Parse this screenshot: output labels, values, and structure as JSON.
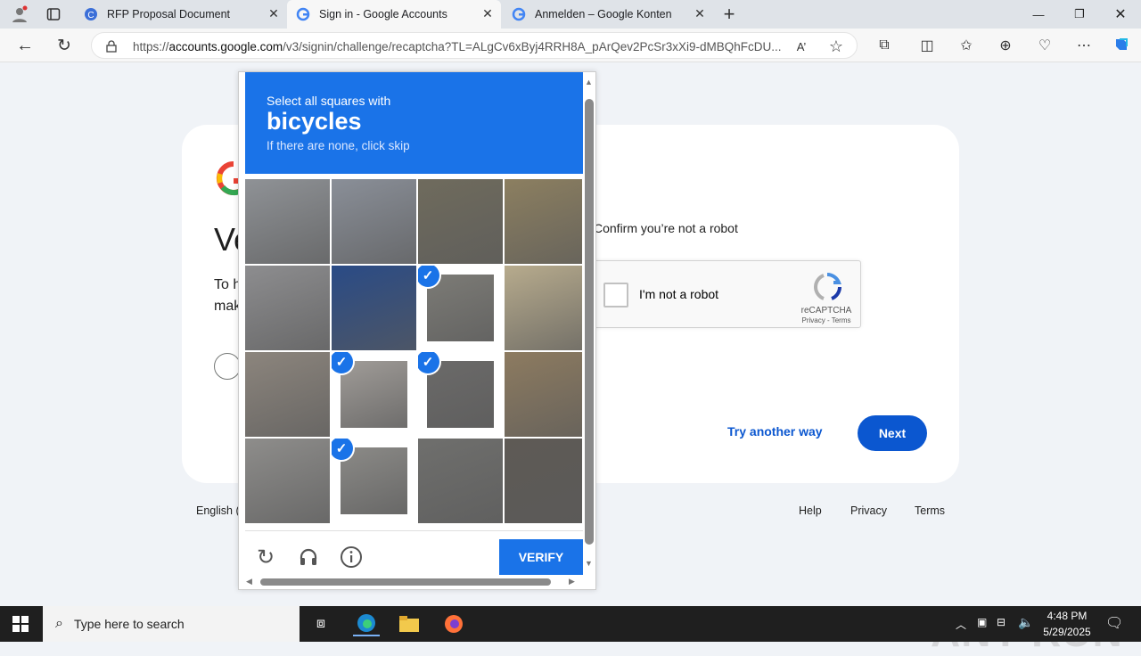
{
  "tabs": [
    {
      "title": "RFP Proposal Document",
      "icon": "edge-document-icon"
    },
    {
      "title": "Sign in - Google Accounts",
      "icon": "google-g-icon"
    },
    {
      "title": "Anmelden – Google Konten",
      "icon": "google-g-icon"
    }
  ],
  "address": {
    "url_prefix": "https://",
    "url_domain": "accounts.google.com",
    "url_path": "/v3/signin/challenge/recaptcha?TL=ALgCv6xByj4RRH8A_pArQev2PcSr3xXi9-dMBQhFcDU..."
  },
  "page": {
    "title_partial": "Ve",
    "text_partial": "To h mak mo",
    "confirm_text": "Confirm you’re not a robot",
    "recaptcha": {
      "label": "I'm not a robot",
      "brand": "reCAPTCHA",
      "links": "Privacy - Terms"
    },
    "try_another": "Try another way",
    "next": "Next",
    "lang_partial": "English (",
    "footer": {
      "help": "Help",
      "privacy": "Privacy",
      "terms": "Terms"
    }
  },
  "captcha": {
    "instruction": "Select all squares with",
    "target": "bicycles",
    "hint": "If there are none, click skip",
    "verify": "VERIFY",
    "tiles": [
      {
        "selected": false,
        "tone": "#8f9296"
      },
      {
        "selected": false,
        "tone": "#8a8f98"
      },
      {
        "selected": false,
        "tone": "#6f6b5d"
      },
      {
        "selected": false,
        "tone": "#8c7f60"
      },
      {
        "selected": false,
        "tone": "#8d8d8f"
      },
      {
        "selected": false,
        "tone": "#2a4b86"
      },
      {
        "selected": true,
        "tone": "#7c7b76"
      },
      {
        "selected": false,
        "tone": "#b7ab8d"
      },
      {
        "selected": false,
        "tone": "#8c857d"
      },
      {
        "selected": true,
        "tone": "#a09c98"
      },
      {
        "selected": true,
        "tone": "#6b6a69"
      },
      {
        "selected": false,
        "tone": "#8d7b60"
      },
      {
        "selected": false,
        "tone": "#8e8d8b"
      },
      {
        "selected": true,
        "tone": "#8b8a87"
      },
      {
        "selected": false,
        "tone": "#6f6f6d"
      },
      {
        "selected": false,
        "tone": "#5e5a55"
      }
    ]
  },
  "watermark": "ANY RUN",
  "taskbar": {
    "search_placeholder": "Type here to search",
    "time": "4:48 PM",
    "date": "5/29/2025"
  }
}
